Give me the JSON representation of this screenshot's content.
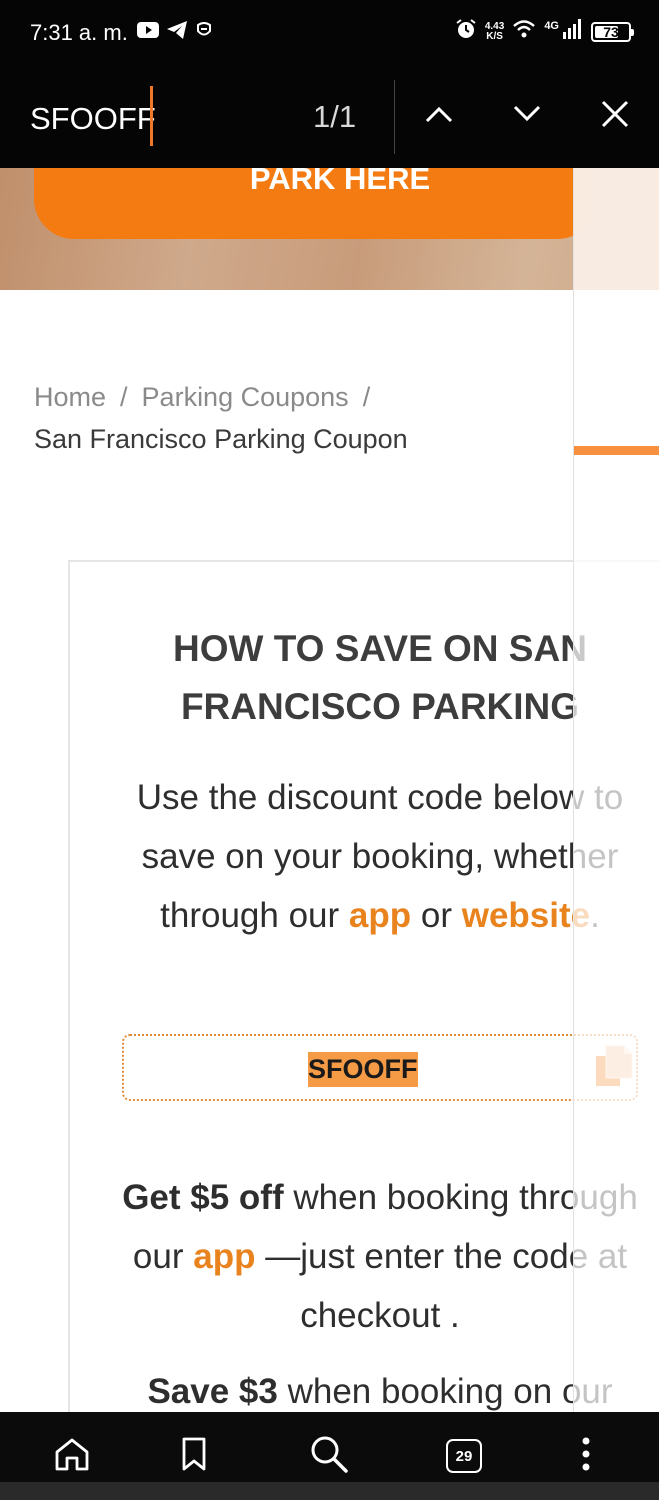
{
  "status_bar": {
    "time": "7:31 a. m.",
    "net_speed_value": "4.43",
    "net_speed_unit": "K/S",
    "network_type": "4G",
    "battery_level": "73",
    "icons_left": [
      "youtube-icon",
      "telegram-icon",
      "notification-app-icon"
    ],
    "icons_right": [
      "alarm-icon",
      "wifi-icon",
      "signal-icon",
      "battery-icon"
    ]
  },
  "find_bar": {
    "query": "SFOOFF",
    "match_count": "1/1"
  },
  "hero": {
    "button_label": "PARK HERE"
  },
  "breadcrumb": {
    "home": "Home",
    "separator": "/",
    "parent": "Parking Coupons",
    "current": "San Francisco Parking Coupon"
  },
  "card": {
    "title_line1": "HOW TO SAVE ON SAN",
    "title_line2": "FRANCISCO PARKING",
    "desc_part1": "Use the discount code below to save on your booking, whether through our",
    "desc_link_app": "app",
    "desc_part2": "or",
    "desc_link_website": "website",
    "desc_part3": ".",
    "coupon_code": "SFOOFF",
    "offer1_bold": "Get $5 off",
    "offer1_part1": "when booking through our",
    "offer1_link": "app",
    "offer1_part2": "—just enter the code at checkout .",
    "offer2_bold": "Save $3",
    "offer2_part1": "when booking on our"
  },
  "bottom_nav": {
    "tab_count": "29"
  },
  "colors": {
    "accent": "#f47b12",
    "link": "#e8831d",
    "find_caret": "#f2772a",
    "highlight": "#f59a45",
    "bar_background": "#050505"
  }
}
